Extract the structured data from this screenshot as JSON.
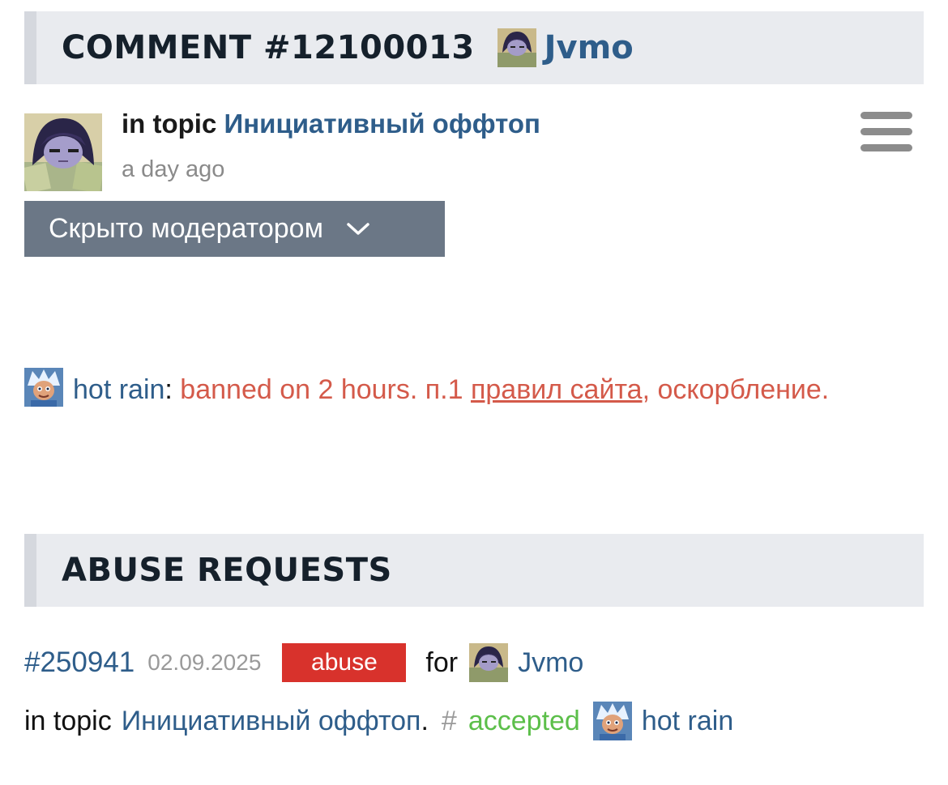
{
  "comment": {
    "header_title": "COMMENT #12100013",
    "author": "Jvmo",
    "topic_prefix": "in topic",
    "topic_name": "Инициативный оффтоп",
    "time_ago": "a day ago",
    "hidden_label": "Скрыто модератором"
  },
  "ban_notice": {
    "moderator": "hot rain",
    "colon": ":",
    "text_before_link": " banned on 2 hours. п.1 ",
    "link_text": "правил сайта",
    "text_after_link": ", оскорбление."
  },
  "abuse": {
    "header_title": "ABUSE REQUESTS",
    "request_id": "#250941",
    "date": "02.09.2025",
    "badge": "abuse",
    "for_label": "for",
    "target_user": "Jvmo",
    "topic_prefix": "in topic",
    "topic_name": "Инициативный оффтоп",
    "topic_suffix": ".",
    "hash": "#",
    "status": "accepted",
    "moderator": "hot rain"
  },
  "colors": {
    "link": "#2e5d8a",
    "ban_text": "#d45a4a",
    "badge": "#d8322c",
    "accepted": "#5cbf4a",
    "hidden_button": "#6b7786"
  },
  "icons": {
    "menu": "hamburger-menu-icon",
    "dropdown": "chevron-down-icon"
  }
}
